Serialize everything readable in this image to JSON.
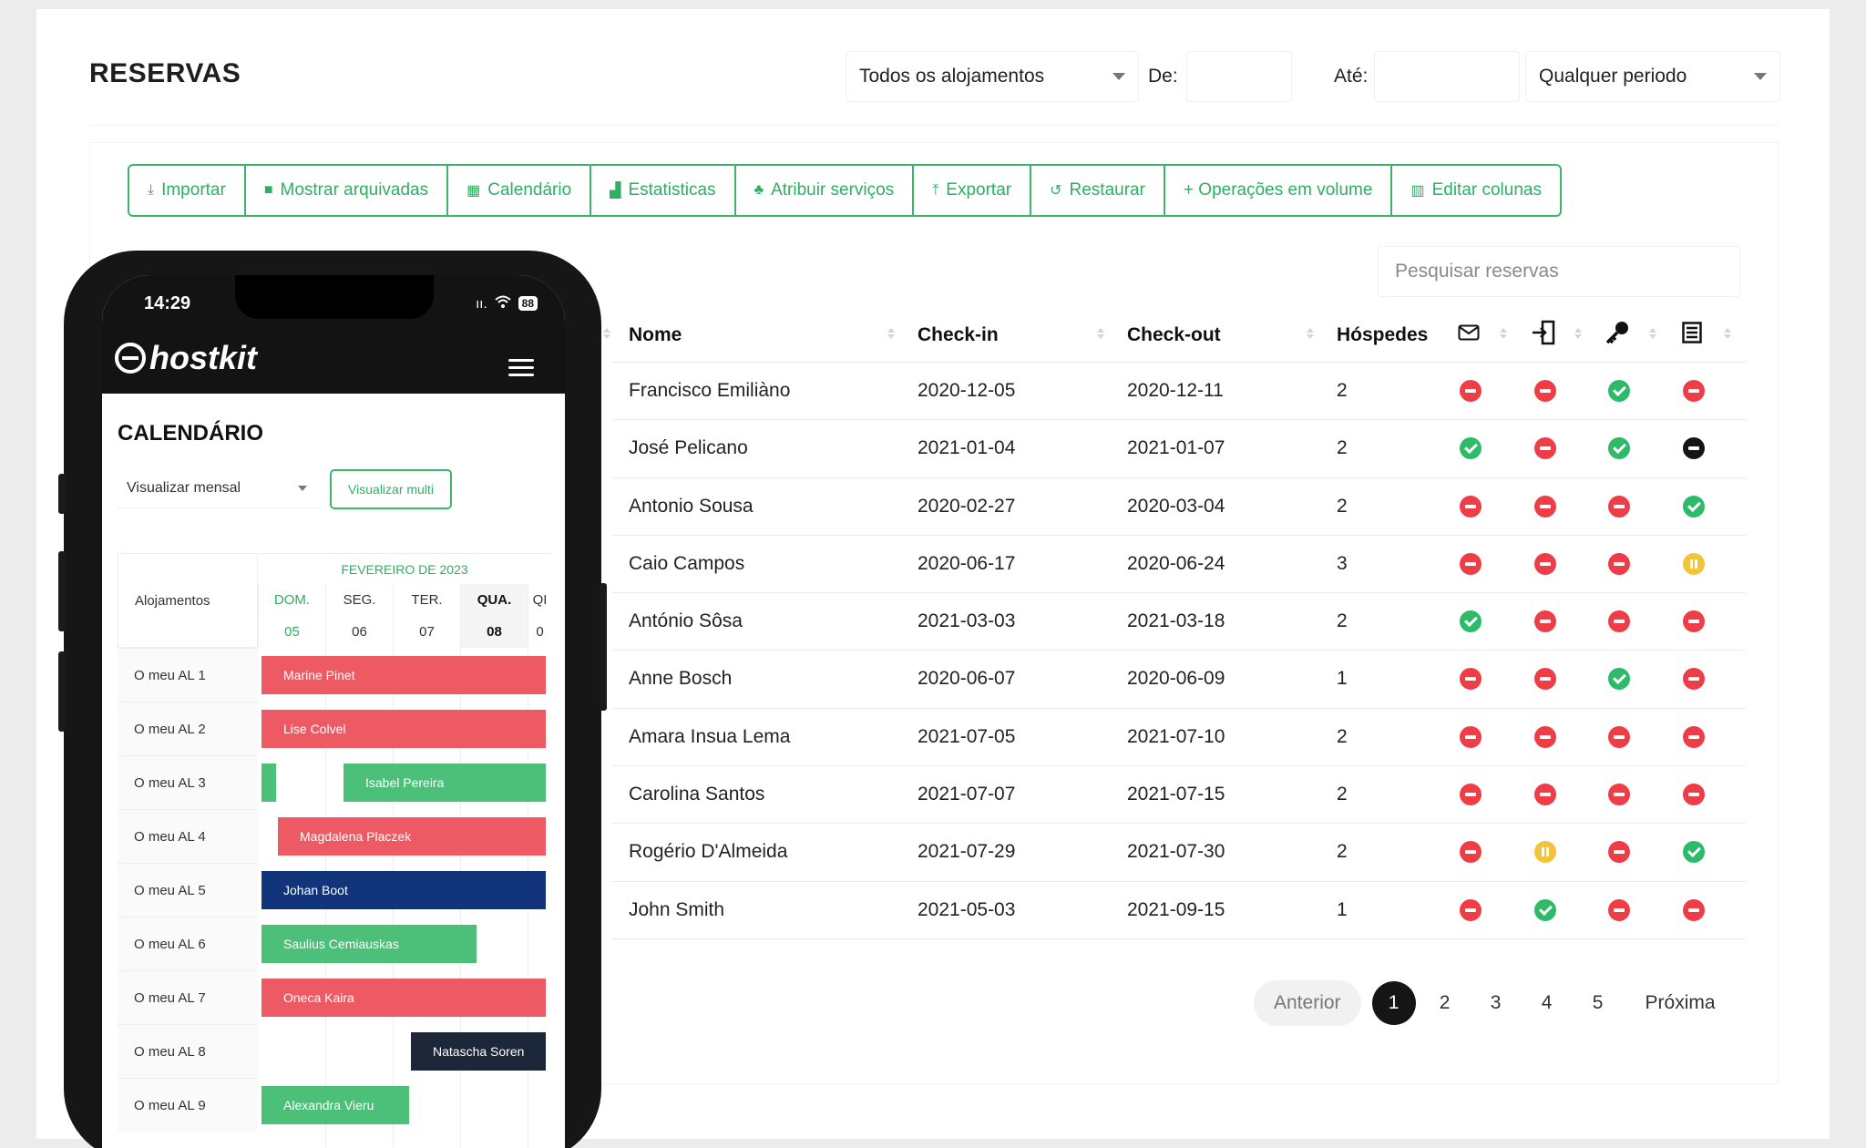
{
  "header": {
    "title": "RESERVAS",
    "accommodation_select": "Todos os alojamentos",
    "from_label": "De:",
    "to_label": "Até:",
    "period_select": "Qualquer periodo"
  },
  "toolbar": {
    "import": "Importar",
    "show_archived": "Mostrar arquivadas",
    "calendar": "Calendário",
    "statistics": "Estatisticas",
    "assign_services": "Atribuir serviços",
    "export": "Exportar",
    "restore": "Restaurar",
    "bulk_ops": "+ Operações em volume",
    "edit_columns": "Editar colunas"
  },
  "search": {
    "placeholder": "Pesquisar reservas"
  },
  "table": {
    "columns": {
      "name": "Nome",
      "checkin": "Check-in",
      "checkout": "Check-out",
      "guests": "Hóspedes"
    },
    "status_colors": {
      "red": "#ef3d47",
      "green": "#2dbb69",
      "black": "#151515",
      "yellow": "#f3c438"
    },
    "icon_columns": [
      "mail-icon",
      "door-icon",
      "key-icon",
      "document-icon"
    ],
    "rows": [
      {
        "name": "Francisco Emiliàno",
        "checkin": "2020-12-05",
        "checkout": "2020-12-11",
        "guests": "2",
        "status": [
          "red",
          "red",
          "green",
          "red"
        ]
      },
      {
        "name": "José Pelicano",
        "checkin": "2021-01-04",
        "checkout": "2021-01-07",
        "guests": "2",
        "status": [
          "green",
          "red",
          "green",
          "black"
        ]
      },
      {
        "name": "Antonio Sousa",
        "checkin": "2020-02-27",
        "checkout": "2020-03-04",
        "guests": "2",
        "status": [
          "red",
          "red",
          "red",
          "green"
        ]
      },
      {
        "name": "Caio Campos",
        "checkin": "2020-06-17",
        "checkout": "2020-06-24",
        "guests": "3",
        "status": [
          "red",
          "red",
          "red",
          "yellow"
        ]
      },
      {
        "name": "António Sôsa",
        "checkin": "2021-03-03",
        "checkout": "2021-03-18",
        "guests": "2",
        "status": [
          "green",
          "red",
          "red",
          "red"
        ]
      },
      {
        "name": "Anne Bosch",
        "checkin": "2020-06-07",
        "checkout": "2020-06-09",
        "guests": "1",
        "status": [
          "red",
          "red",
          "green",
          "red"
        ]
      },
      {
        "name": "Amara Insua Lema",
        "checkin": "2021-07-05",
        "checkout": "2021-07-10",
        "guests": "2",
        "status": [
          "red",
          "red",
          "red",
          "red"
        ]
      },
      {
        "name": "Carolina Santos",
        "checkin": "2021-07-07",
        "checkout": "2021-07-15",
        "guests": "2",
        "status": [
          "red",
          "red",
          "red",
          "red"
        ]
      },
      {
        "name": "Rogério D'Almeida",
        "checkin": "2021-07-29",
        "checkout": "2021-07-30",
        "guests": "2",
        "status": [
          "red",
          "yellow",
          "red",
          "green"
        ]
      },
      {
        "name": "John Smith",
        "checkin": "2021-05-03",
        "checkout": "2021-09-15",
        "guests": "1",
        "status": [
          "red",
          "green",
          "red",
          "red"
        ]
      }
    ]
  },
  "pagination": {
    "prev": "Anterior",
    "pages": [
      "1",
      "2",
      "3",
      "4",
      "5"
    ],
    "active": "1",
    "next": "Próxima"
  },
  "phone": {
    "time": "14:29",
    "signal": "ıı.",
    "battery": "88",
    "brand": "hostkit",
    "screen_title": "CALENDÁRIO",
    "view_select": "Visualizar mensal",
    "view_multi": "Visualizar multi",
    "calendar": {
      "column_header": "Alojamentos",
      "month": "FEVEREIRO DE 2023",
      "days": [
        {
          "name": "DOM.",
          "num": "05"
        },
        {
          "name": "SEG.",
          "num": "06"
        },
        {
          "name": "TER.",
          "num": "07"
        },
        {
          "name": "QUA.",
          "num": "08"
        },
        {
          "name": "QI",
          "num": "0"
        }
      ],
      "properties": [
        "O meu AL 1",
        "O meu AL 2",
        "O meu AL 3",
        "O meu AL 4",
        "O meu AL 5",
        "O meu AL 6",
        "O meu AL 7",
        "O meu AL 8",
        "O meu AL 9"
      ],
      "bookings": [
        {
          "label": "Marine Pinet",
          "color": "red"
        },
        {
          "label": "Lise Colvel",
          "color": "red"
        },
        {
          "label": "Isabel Pereira",
          "color": "green"
        },
        {
          "label": "Magdalena Placzek",
          "color": "red"
        },
        {
          "label": "Johan Boot",
          "color": "navy"
        },
        {
          "label": "Saulius Cemiauskas",
          "color": "green"
        },
        {
          "label": "Oneca Kaira",
          "color": "red"
        },
        {
          "label": "Natascha Soren",
          "color": "dark"
        },
        {
          "label": "Alexandra Vieru",
          "color": "green"
        }
      ]
    }
  }
}
